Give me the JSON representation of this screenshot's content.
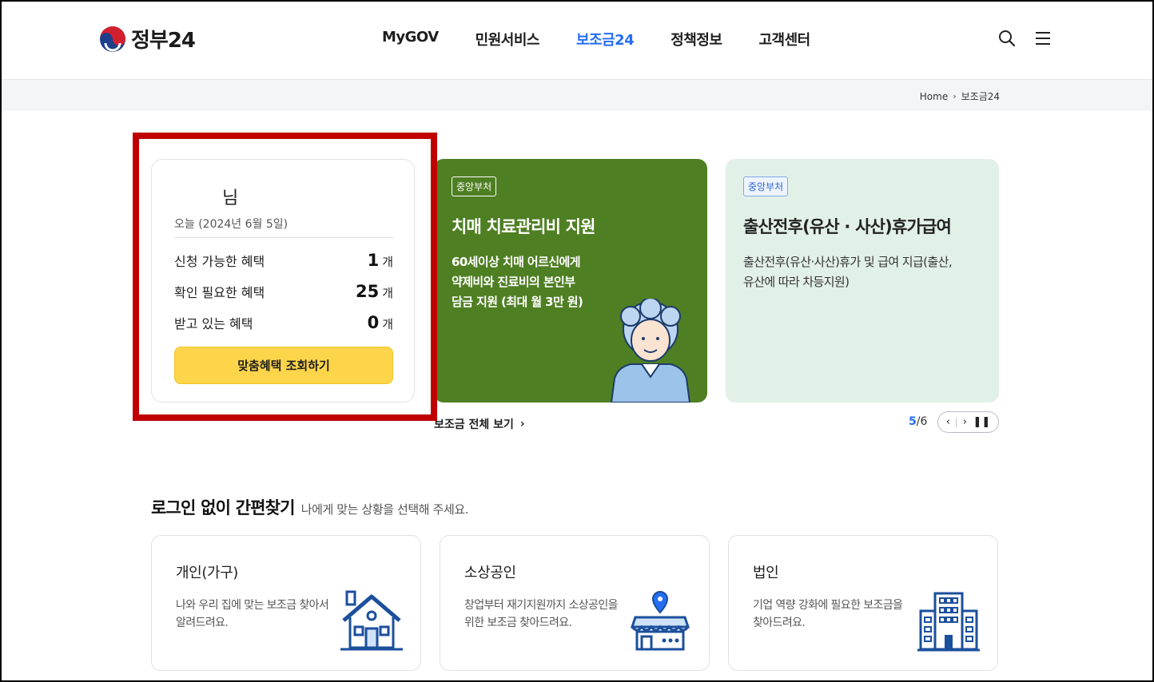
{
  "header": {
    "logo_text": "정부24",
    "nav": [
      "MyGOV",
      "민원서비스",
      "보조금24",
      "정책정보",
      "고객센터"
    ],
    "active_nav": "보조금24"
  },
  "breadcrumb": {
    "home": "Home",
    "current": "보조금24"
  },
  "user_card": {
    "name": "님",
    "date": "오늘 (2024년 6월 5일)",
    "stats": [
      {
        "label": "신청 가능한 혜택",
        "value": "1",
        "unit": "개"
      },
      {
        "label": "확인 필요한 혜택",
        "value": "25",
        "unit": "개"
      },
      {
        "label": "받고 있는 혜택",
        "value": "0",
        "unit": "개"
      }
    ],
    "cta_label": "맞춤혜택 조회하기"
  },
  "slides": [
    {
      "badge": "중앙부처",
      "title": "치매 치료관리비 지원",
      "desc": [
        "60세이상 치매 어르신에게",
        "약제비와 진료비의 본인부",
        "담금 지원 (최대 월 3만 원)"
      ]
    },
    {
      "badge": "중앙부처",
      "title": "출산전후(유산 · 사산)휴가급여",
      "desc": [
        "출산전후(유산·사산)휴가 및 급여 지급(출산,",
        "유산에 따라 차등지원)"
      ]
    }
  ],
  "all_link": "보조금 전체 보기",
  "pager": {
    "current": "5",
    "total": "6"
  },
  "section": {
    "title": "로그인 없이 간편찾기",
    "subtitle": "나에게 맞는 상황을 선택해 주세요."
  },
  "categories": [
    {
      "title": "개인(가구)",
      "desc": "나와 우리 집에 맞는 보조금 찾아서 알려드려요.",
      "icon": "house-icon"
    },
    {
      "title": "소상공인",
      "desc": "창업부터 재기지원까지 소상공인을 위한 보조금 찾아드려요.",
      "icon": "shop-icon"
    },
    {
      "title": "법인",
      "desc": "기업 역량 강화에 필요한 보조금을 찾아드려요.",
      "icon": "building-icon"
    }
  ],
  "colors": {
    "accent": "#256ef4",
    "cta": "#fdd54a",
    "green_slide": "#4f7f23",
    "mint_slide": "#e2f1e8",
    "highlight": "#c00000"
  }
}
